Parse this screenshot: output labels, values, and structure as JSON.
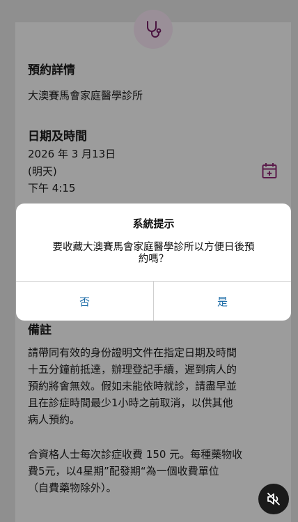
{
  "booking": {
    "details_heading": "預約詳情",
    "clinic_name": "大澳賽馬會家庭醫學診所",
    "datetime_heading": "日期及時間",
    "date": "2026 年 3 月13日",
    "day_note": "(明天)",
    "time": "下午 4:15",
    "remarks_heading": "備註",
    "remarks_lines": [
      "請帶同有效的身份證明文件在指定日期及時間",
      "十五分鐘前抵達，辦理登記手續，遲到病人的",
      "預約將會無效。假如未能依時就診，請盡早並",
      "且在診症時間最少1小時之前取消，以供其他",
      "病人預約。"
    ],
    "fee_lines": [
      "合資格人士每次診症收費 150 元。每種藥物收",
      "費5元，以4星期”配發期“為一個收費單位",
      "（自費藥物除外）。"
    ]
  },
  "dialog": {
    "title": "系統提示",
    "message_line1": "要收藏大澳賽馬會家庭醫學診所以方便日後預",
    "message_line2": "約嗎？",
    "no_label": "否",
    "yes_label": "是"
  },
  "icons": {
    "header": "stethoscope-icon",
    "calendar": "calendar-add-icon",
    "mute": "speaker-muted-icon"
  },
  "colors": {
    "accent": "#5a1a4a",
    "dialog_button": "#1f6ea8"
  }
}
